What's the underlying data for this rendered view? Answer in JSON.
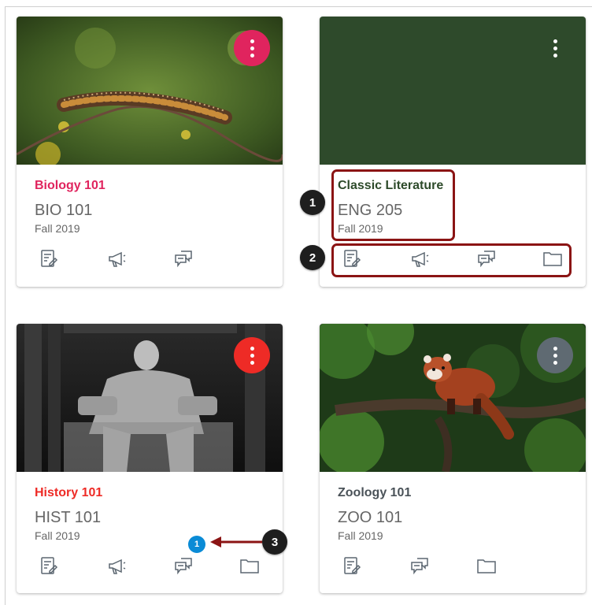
{
  "cards": [
    {
      "title": "Biology 101",
      "code": "BIO 101",
      "term": "Fall 2019",
      "title_color": "#e0245e",
      "menu_color": "#e0245e",
      "image_icon": "caterpillar-photo"
    },
    {
      "title": "Classic Literature",
      "code": "ENG 205",
      "term": "Fall 2019",
      "title_color": "#2d4a2a",
      "hero_color": "#2e4a2b"
    },
    {
      "title": "History 101",
      "code": "HIST 101",
      "term": "Fall 2019",
      "title_color": "#ee2b26",
      "menu_color": "#ee2b26",
      "image_icon": "lincoln-memorial-photo"
    },
    {
      "title": "Zoology 101",
      "code": "ZOO 101",
      "term": "Fall 2019",
      "title_color": "#4a5258",
      "menu_color": "#5f6a72",
      "image_icon": "red-panda-photo"
    }
  ],
  "callouts": [
    "1",
    "2",
    "3"
  ],
  "unread_badge": "1",
  "colors": {
    "annotation": "#8b1414",
    "icon": "#5b6670",
    "badge": "#0a8bd6"
  }
}
